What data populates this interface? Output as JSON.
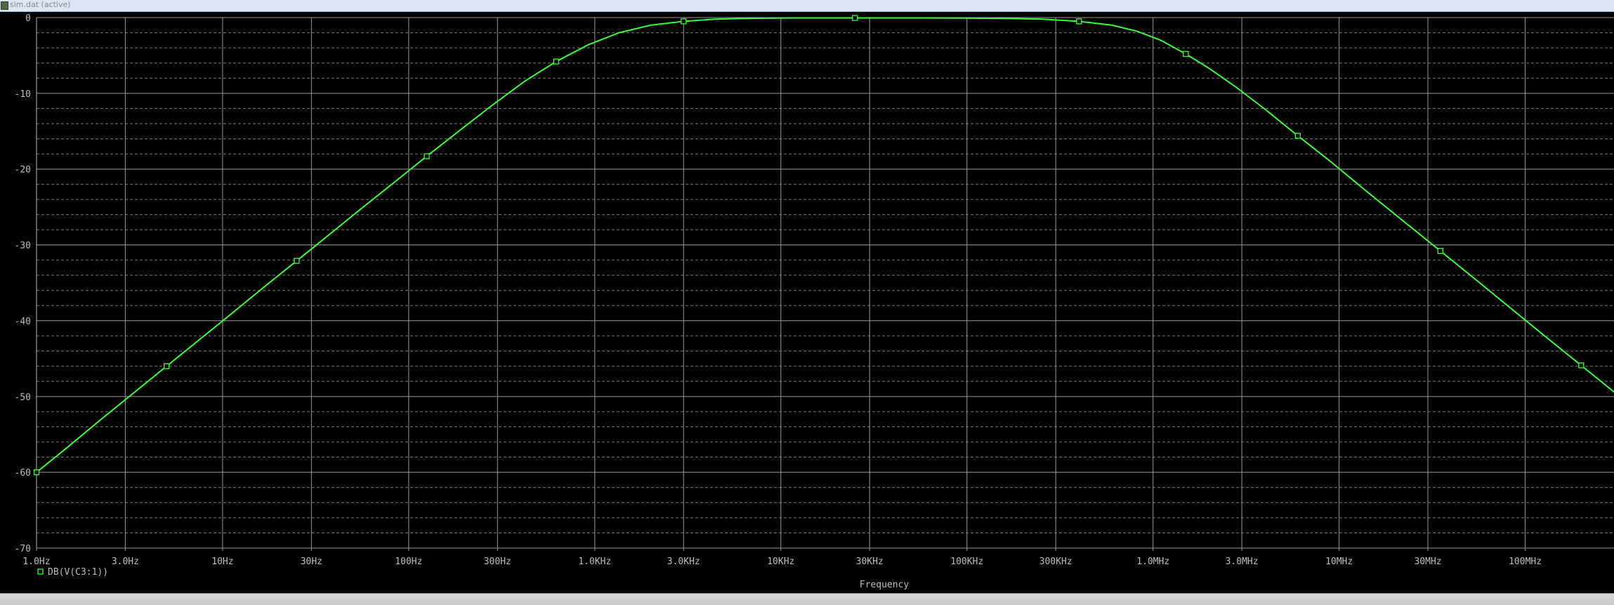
{
  "window": {
    "title": "sim.dat (active)"
  },
  "colors": {
    "background": "#000000",
    "trace": "#33ff33",
    "grid_major": "#9a9a9a",
    "grid_minor": "#7a7a7a",
    "text": "#bdbdbd"
  },
  "chart_data": {
    "type": "line",
    "title": "",
    "xlabel": "Frequency",
    "ylabel": "",
    "x_scale": "log",
    "xlim": [
      1,
      300000000
    ],
    "ylim": [
      -70,
      0
    ],
    "grid": true,
    "legend": "bottom-left",
    "x_tick_values": [
      1,
      3,
      10,
      30,
      100,
      300,
      1000,
      3000,
      10000,
      30000,
      100000,
      300000,
      1000000,
      3000000,
      10000000,
      30000000,
      100000000
    ],
    "x_tick_labels": [
      "1.0Hz",
      "3.0Hz",
      "10Hz",
      "30Hz",
      "100Hz",
      "300Hz",
      "1.0KHz",
      "3.0KHz",
      "10KHz",
      "30KHz",
      "100KHz",
      "300KHz",
      "1.0MHz",
      "3.0MHz",
      "10MHz",
      "30MHz",
      "100MHz"
    ],
    "y_tick_values": [
      0,
      -10,
      -20,
      -30,
      -40,
      -50,
      -60,
      -70
    ],
    "y_tick_labels": [
      "0",
      "-10",
      "-20",
      "-30",
      "-40",
      "-50",
      "-60",
      "-70"
    ],
    "series": [
      {
        "name": "DB(V(C3:1))",
        "color": "#33ff33",
        "x": [
          1.0,
          1.5,
          2.2,
          3.3,
          5.0,
          7.5,
          11.0,
          17.0,
          25.0,
          38.0,
          55.0,
          85.0,
          125.0,
          190.0,
          280.0,
          420.0,
          620.0,
          920.0,
          1350.0,
          2000.0,
          3000.0,
          4500.0,
          7000.0,
          12000.0,
          25000.0,
          60000.0,
          150000.0,
          250000.0,
          400000.0,
          600000.0,
          820000.0,
          1100000.0,
          1500000.0,
          2000000.0,
          2800000.0,
          4000000.0,
          6000000.0,
          9000000.0,
          14000000.0,
          22000000.0,
          35000000.0,
          55000000.0,
          85000000.0,
          130000000.0,
          200000000.0,
          300000000.0
        ],
        "y": [
          -60.0,
          -56.5,
          -53.1,
          -49.6,
          -46.0,
          -42.5,
          -39.2,
          -35.4,
          -32.1,
          -28.5,
          -25.3,
          -21.6,
          -18.3,
          -14.8,
          -11.6,
          -8.4,
          -5.8,
          -3.6,
          -2.0,
          -1.0,
          -0.5,
          -0.2,
          -0.1,
          -0.05,
          -0.05,
          -0.05,
          -0.1,
          -0.2,
          -0.5,
          -1.0,
          -1.8,
          -3.0,
          -4.8,
          -6.7,
          -9.2,
          -12.1,
          -15.6,
          -19.0,
          -22.9,
          -26.8,
          -30.8,
          -34.7,
          -38.5,
          -42.2,
          -45.9,
          -49.4
        ]
      }
    ]
  }
}
